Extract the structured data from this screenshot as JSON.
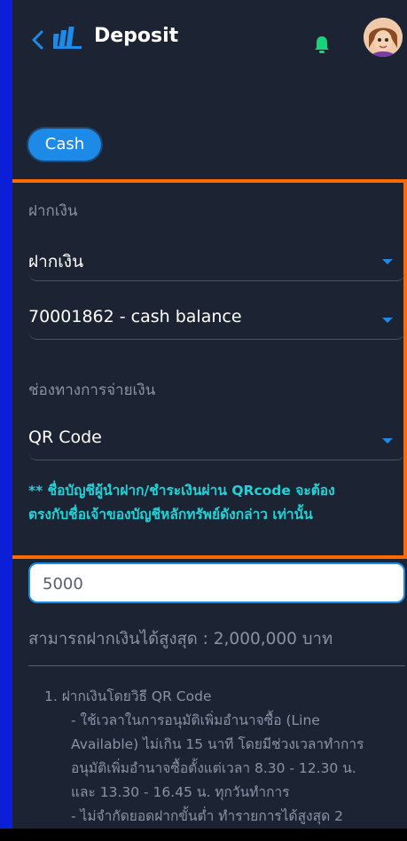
{
  "header": {
    "title": "Deposit"
  },
  "tabs": {
    "cash_label": "Cash"
  },
  "form": {
    "type_label": "ฝากเงิน",
    "type_value": "ฝากเงิน",
    "account_value": "70001862 - cash balance",
    "channel_label": "ช่องทางการจ่ายเงิน",
    "channel_value": "QR Code",
    "note_line1": "** ชื่อบัญชีผู้นำฝาก/ชำระเงินผ่าน QRcode จะต้อง",
    "note_line2": "ตรงกับชื่อเจ้าของบัญชีหลักทรัพย์ดังกล่าว เท่านั้น",
    "amount_value": "5000",
    "max_text": "สามารถฝากเงินได้สูงสุด : 2,000,000 บาท"
  },
  "info": {
    "item1_title": "1. ฝากเงินโดยวิธี QR Code",
    "item1_line1": "- ใช้เวลาในการอนุมัติเพิ่มอำนาจซื้อ (Line",
    "item1_line2": "Available) ไม่เกิน 15 นาที โดยมีช่วงเวลาทำการ",
    "item1_line3": "อนุมัติเพิ่มอำนาจซื้อตั้งแต่เวลา 8.30 - 12.30 น.",
    "item1_line4": "และ 13.30 - 16.45 น. ทุกวันทำการ",
    "item1_line5": "- ไม่จำกัดยอดฝากขั้นต่ำ ทำรายการได้สูงสุด 2"
  },
  "colors": {
    "background": "#1c2433",
    "accent": "#1e8ae8",
    "highlight_border": "#ff6a00",
    "note_text": "#1fd4d8",
    "bell": "#19d37a"
  },
  "icons": {
    "back": "chevron-left-icon",
    "logo": "app-logo-icon",
    "bell": "bell-icon",
    "avatar": "avatar"
  }
}
